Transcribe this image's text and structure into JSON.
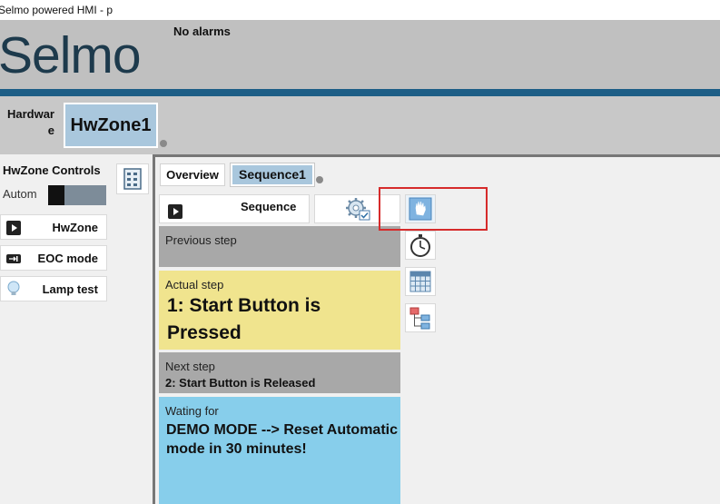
{
  "window": {
    "title": "Selmo powered HMI - p"
  },
  "header": {
    "logo": "Selmo",
    "alarm_status": "No alarms"
  },
  "hardware": {
    "label": "Hardware",
    "zone_tab": "HwZone1"
  },
  "controls": {
    "title": "HwZone Controls",
    "mode_label": "Autom",
    "buttons": {
      "hwzone": "HwZone",
      "eoc": "EOC mode",
      "lamp": "Lamp test"
    }
  },
  "tabs": {
    "overview": "Overview",
    "sequence": "Sequence1"
  },
  "sequence": {
    "button_label": "Sequence",
    "previous_caption": "Previous step",
    "previous_value": "",
    "actual_caption": "Actual step",
    "actual_value": "1: Start Button is Pressed",
    "next_caption": "Next step",
    "next_value": "2: Start Button is Released",
    "waiting_caption": "Wating for",
    "waiting_value": "DEMO MODE --> Reset Automatic mode in 30 minutes!"
  },
  "colors": {
    "brand": "#1d3a4c",
    "accent_bar": "#1d5e86",
    "active_tab": "#a9c7dd",
    "actual_step": "#f0e48e",
    "waiting": "#87ceeb",
    "highlight": "#d62b2b"
  },
  "icons": [
    "play-icon",
    "eoc-icon",
    "lamp-icon",
    "settings-gear-icon",
    "hand-icon",
    "stopwatch-icon",
    "grid-icon",
    "tree-icon",
    "io-view-icon"
  ]
}
